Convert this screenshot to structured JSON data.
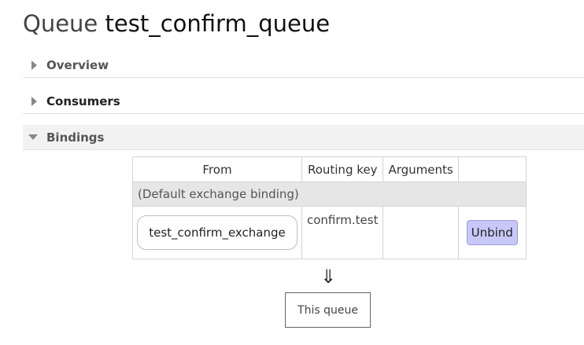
{
  "page": {
    "title_prefix": "Queue",
    "queue_name": "test_confirm_queue"
  },
  "sections": {
    "overview": "Overview",
    "consumers": "Consumers",
    "bindings": "Bindings"
  },
  "bindings_table": {
    "headers": [
      "From",
      "Routing key",
      "Arguments",
      ""
    ],
    "default_binding": "(Default exchange binding)",
    "rows": [
      {
        "from": "test_confirm_exchange",
        "routing_key": "confirm.test",
        "arguments": "",
        "action": "Unbind"
      }
    ]
  },
  "flow": {
    "arrow": "⇓",
    "target": "This queue"
  },
  "colors": {
    "unbind_button": "#c7c8f8",
    "bindings_header_bg": "#f2f2f2"
  }
}
